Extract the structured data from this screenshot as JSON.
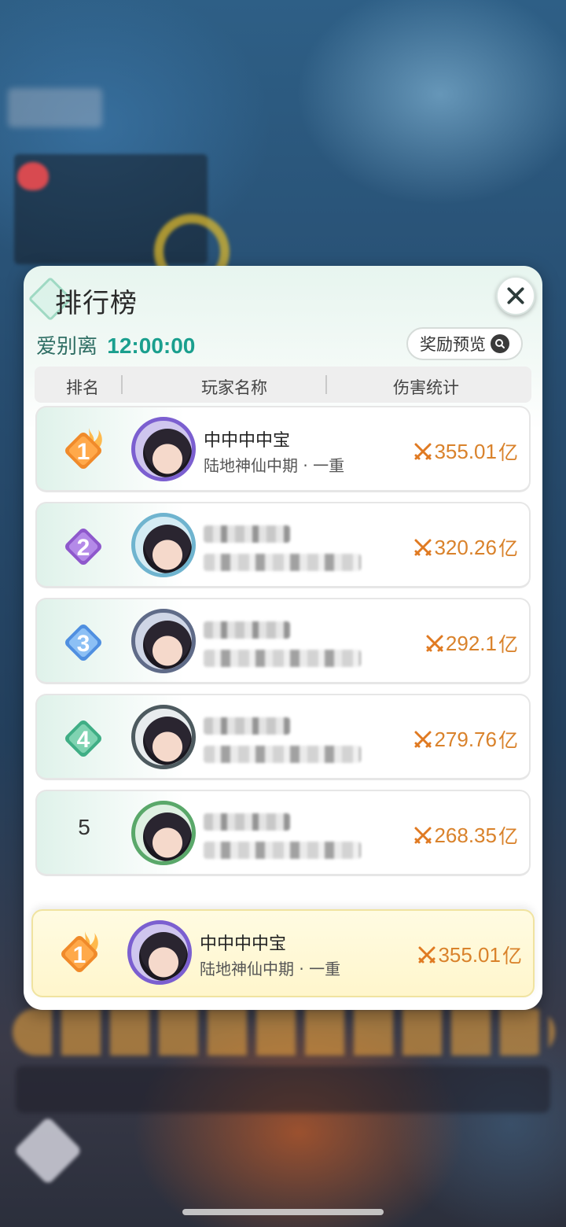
{
  "panel": {
    "title": "排行榜",
    "boss_name": "爱别离",
    "timer": "12:00:00",
    "reward_preview": "奖励预览"
  },
  "columns": [
    "排名",
    "玩家名称",
    "伤害统计"
  ],
  "rankings": [
    {
      "rank": "1",
      "name": "中中中中宝",
      "realm": "陆地神仙中期 · 一重",
      "damage": "355.01",
      "unit": "亿",
      "badge_color": "#f08a2a"
    },
    {
      "rank": "2",
      "name": "",
      "realm": "",
      "damage": "320.26",
      "unit": "亿",
      "badge_color": "#9a62d6"
    },
    {
      "rank": "3",
      "name": "",
      "realm": "",
      "damage": "292.1",
      "unit": "亿",
      "badge_color": "#4f8fe0"
    },
    {
      "rank": "4",
      "name": "",
      "realm": "",
      "damage": "279.76",
      "unit": "亿",
      "badge_color": "#3fae85"
    },
    {
      "rank": "5",
      "name": "",
      "realm": "",
      "damage": "268.35",
      "unit": "亿",
      "badge_color": ""
    }
  ],
  "self_entry": {
    "rank": "1",
    "name": "中中中中宝",
    "realm": "陆地神仙中期 · 一重",
    "damage": "355.01",
    "unit": "亿"
  },
  "colors": {
    "accent": "#1a9f8e",
    "damage": "#d9822b",
    "self_highlight": "#fff6cc"
  }
}
